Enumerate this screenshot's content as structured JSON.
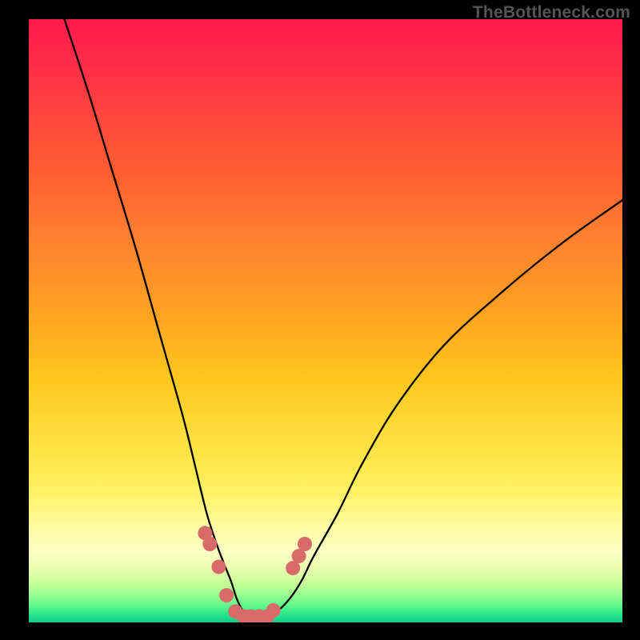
{
  "watermark": {
    "text": "TheBottleneck.com"
  },
  "colors": {
    "curve_stroke": "#000000",
    "marker_fill": "#d86a6a",
    "marker_stroke": "#c45a5a"
  },
  "chart_data": {
    "type": "line",
    "title": "",
    "xlabel": "",
    "ylabel": "",
    "xlim": [
      0,
      100
    ],
    "ylim": [
      0,
      100
    ],
    "grid": false,
    "legend": false,
    "series": [
      {
        "name": "bottleneck-curve",
        "x": [
          6,
          10,
          14,
          18,
          22,
          26,
          28,
          30,
          32,
          34,
          35,
          36,
          37,
          38,
          40,
          42,
          44,
          46,
          48,
          52,
          56,
          62,
          70,
          80,
          90,
          100
        ],
        "y": [
          100,
          88,
          75,
          62,
          48,
          34,
          26,
          18,
          12,
          7,
          4,
          2,
          1,
          1,
          1.2,
          2,
          4,
          7,
          11,
          18,
          26,
          36,
          46,
          55,
          63,
          70
        ]
      }
    ],
    "markers": [
      {
        "x": 29.7,
        "y": 14.8
      },
      {
        "x": 30.5,
        "y": 13.0
      },
      {
        "x": 32.0,
        "y": 9.2
      },
      {
        "x": 33.3,
        "y": 4.5
      },
      {
        "x": 34.8,
        "y": 1.8
      },
      {
        "x": 36.2,
        "y": 1.0
      },
      {
        "x": 37.4,
        "y": 1.0
      },
      {
        "x": 38.8,
        "y": 1.0
      },
      {
        "x": 40.2,
        "y": 1.0
      },
      {
        "x": 41.2,
        "y": 2.0
      },
      {
        "x": 44.5,
        "y": 9.0
      },
      {
        "x": 45.5,
        "y": 11.0
      },
      {
        "x": 46.5,
        "y": 13.0
      }
    ]
  }
}
